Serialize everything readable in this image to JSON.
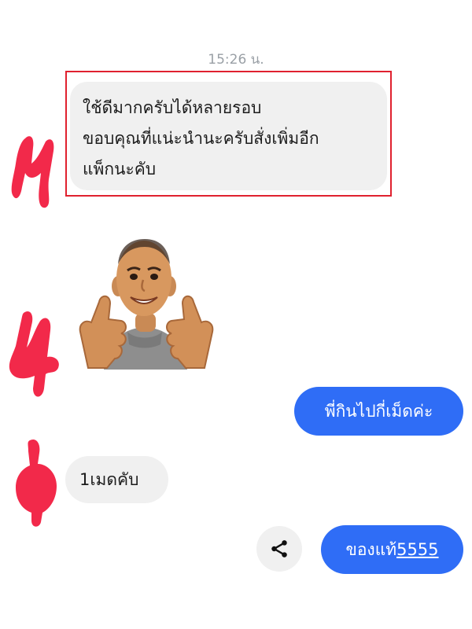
{
  "chat": {
    "timestamp": "15:26 น.",
    "messages": [
      {
        "from": "them",
        "text_lines": [
          "ใช้ดีมากครับได้หลายรอบ",
          "ขอบคุณที่แน่ะนำนะครับสั่งเพิ่มอีก",
          "แพ็กนะคับ"
        ]
      },
      {
        "from": "them",
        "type": "sticker",
        "sticker": "thumbs-up-man-sticker"
      },
      {
        "from": "me",
        "text": "พี่กินไปกี่เม็ดค่ะ"
      },
      {
        "from": "them",
        "text": "1เมดคับ"
      },
      {
        "from": "me",
        "text_prefix": "ของแท้",
        "text_link": "5555"
      }
    ]
  },
  "colors": {
    "outgoing_bubble": "#2f6df6",
    "incoming_bubble": "#f0f0f0",
    "highlight_border": "#e0212f",
    "redaction": "#f2294a"
  },
  "icons": {
    "share": "share-icon"
  }
}
